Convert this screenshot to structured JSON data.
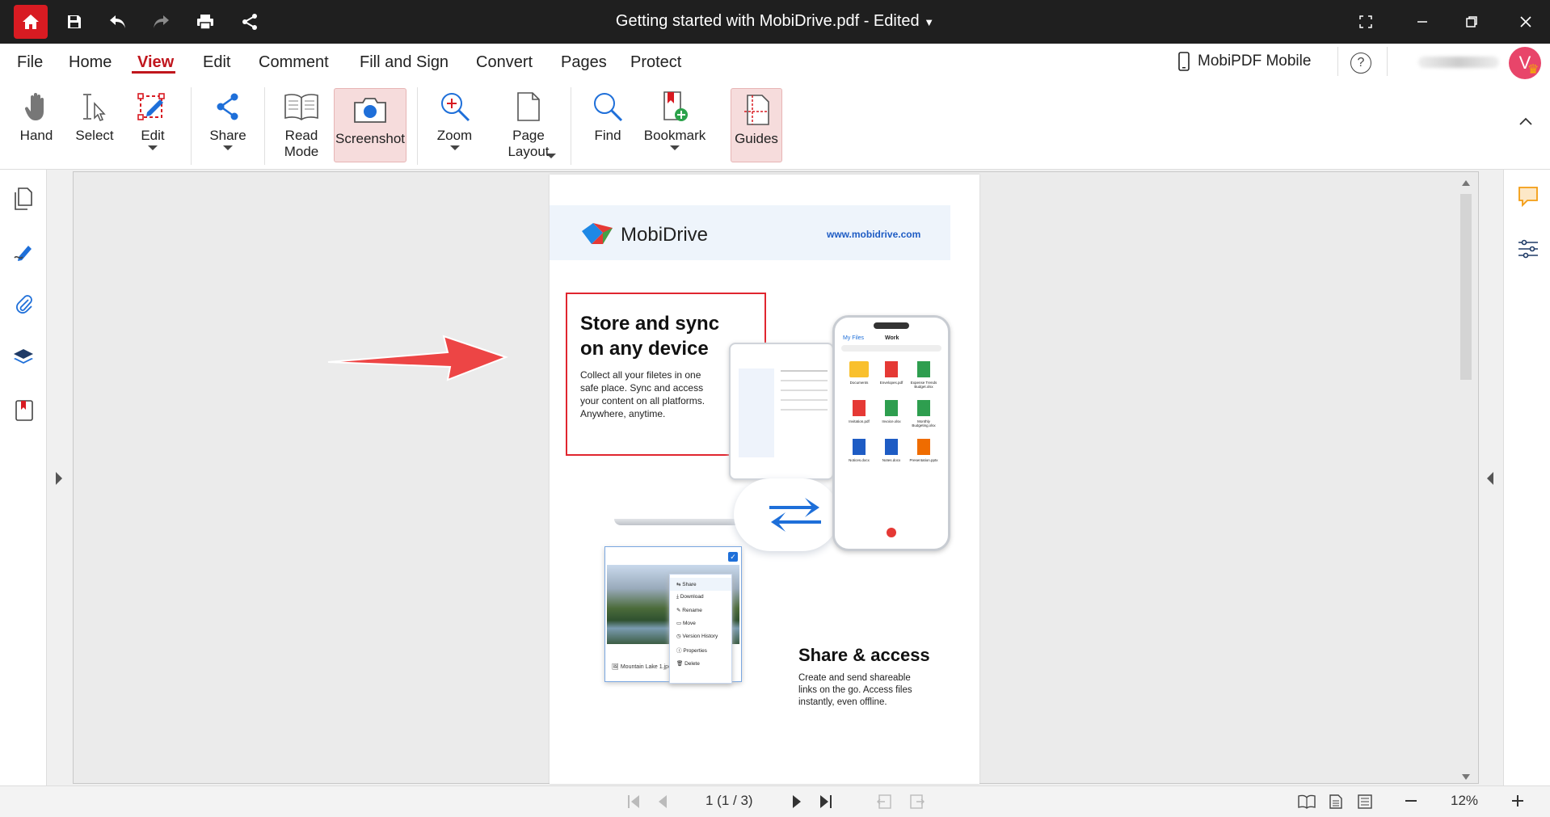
{
  "titlebar": {
    "title": "Getting started with MobiDrive.pdf - Edited",
    "icons": [
      "home-icon",
      "save-icon",
      "undo-icon",
      "redo-icon",
      "print-icon",
      "share-icon"
    ],
    "brand_color": "#d81b22"
  },
  "menu": {
    "items": [
      "File",
      "Home",
      "View",
      "Edit",
      "Comment",
      "Fill and Sign",
      "Convert",
      "Pages",
      "Protect"
    ],
    "active": "View",
    "mobile_label": "MobiPDF Mobile",
    "avatar_letter": "V"
  },
  "ribbon": {
    "hand": "Hand",
    "select": "Select",
    "edit": "Edit",
    "share": "Share",
    "read_mode_1": "Read",
    "read_mode_2": "Mode",
    "screenshot": "Screenshot",
    "zoom": "Zoom",
    "page_layout_1": "Page",
    "page_layout_2": "Layout",
    "find": "Find",
    "bookmark": "Bookmark",
    "guides": "Guides"
  },
  "document": {
    "brand": "MobiDrive",
    "url": "www.mobidrive.com",
    "heading1_line1": "Store and sync",
    "heading1_line2": "on any device",
    "body1_l1": "Collect all your filetes in one",
    "body1_l2": "safe place. Sync and access",
    "body1_l3": "your content on all platforms.",
    "body1_l4": "Anywhere, anytime.",
    "heading2": "Share & access",
    "body2_l1": "Create and send shareable",
    "body2_l2": "links on the go. Access files",
    "body2_l3": "instantly, even offline.",
    "image_caption": "Mountain Lake 1.jpeg",
    "context_menu": [
      "Share",
      "Download",
      "Rename",
      "Move",
      "Version History",
      "Properties",
      "Delete"
    ],
    "phone_header": "Work",
    "phone_back": "My Files",
    "phone_files": [
      {
        "name": "Documents"
      },
      {
        "name": "Envelopes.pdf"
      },
      {
        "name": "Expense Trends Budget.xlsx"
      },
      {
        "name": "Invitation.pdf"
      },
      {
        "name": "Invoice.xlsx"
      },
      {
        "name": "Monthly Budgeting.xlsx"
      },
      {
        "name": "Notices.docx"
      },
      {
        "name": "Notes.docx"
      },
      {
        "name": "Presentation.pptx"
      }
    ]
  },
  "status": {
    "page": "1 (1 / 3)",
    "zoom": "12%"
  }
}
